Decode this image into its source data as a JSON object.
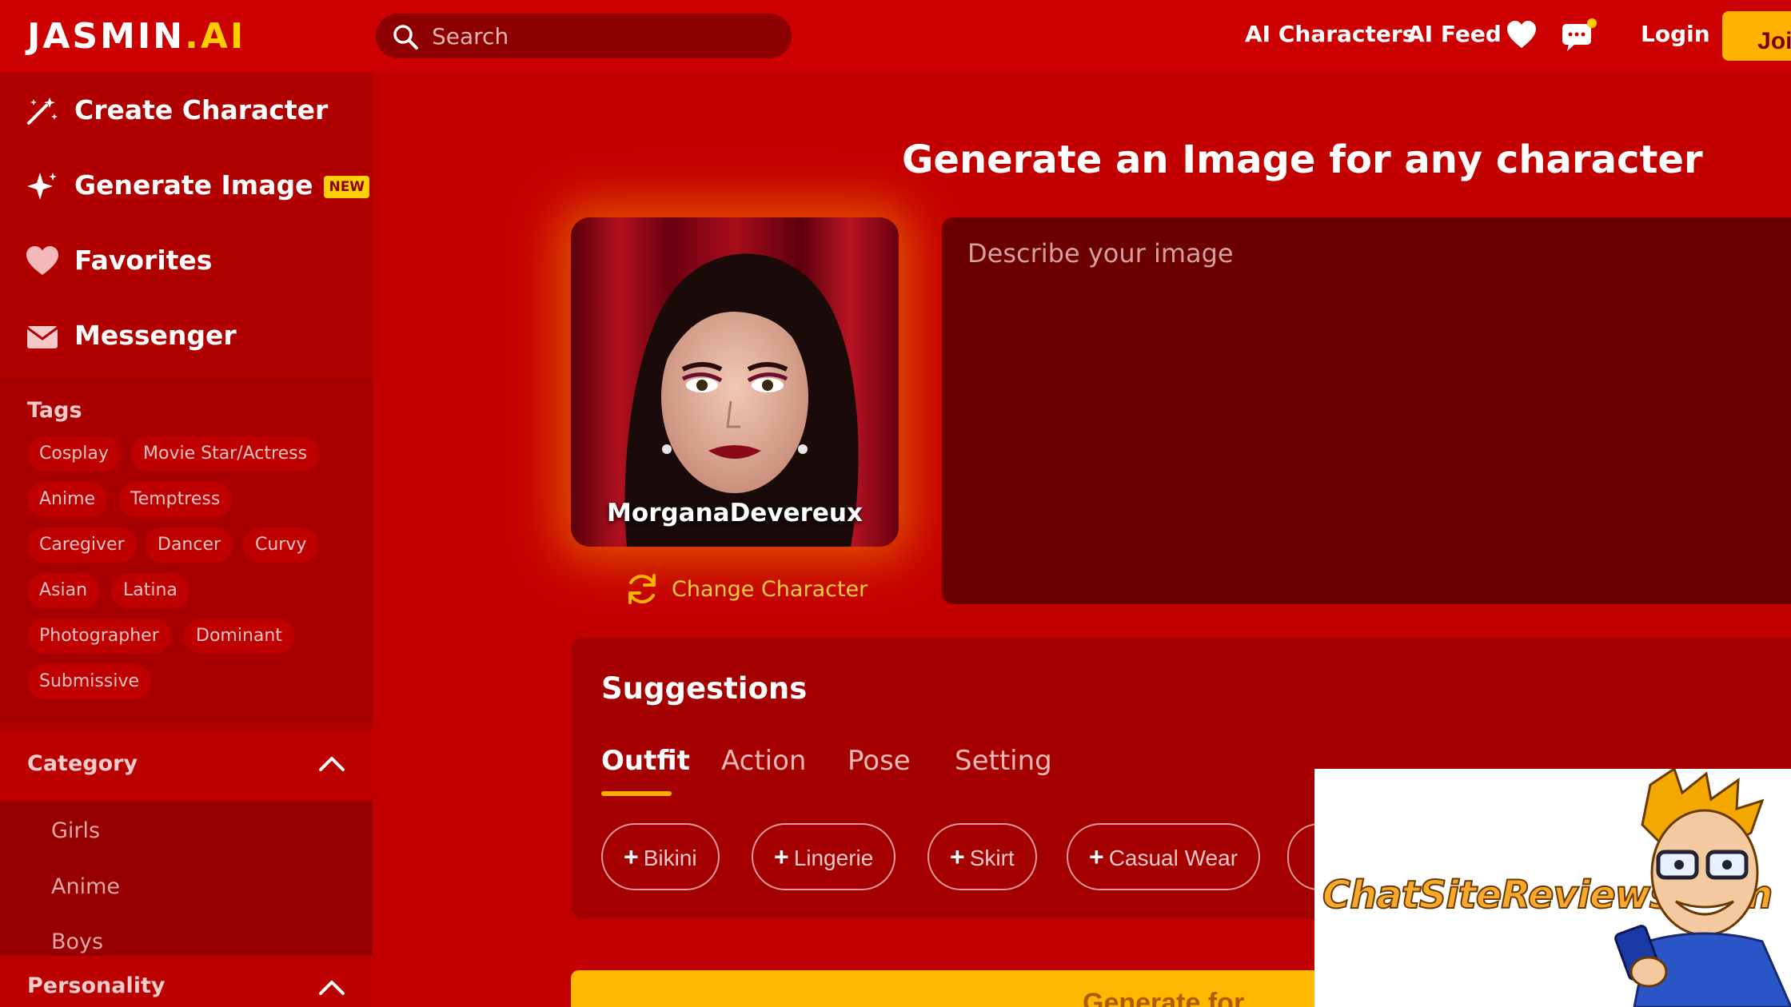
{
  "header": {
    "logo_main": "JASMIN",
    "logo_dot": ".",
    "logo_suffix": "AI",
    "search_placeholder": "Search",
    "nav_ai_characters": "AI Characters",
    "nav_ai_feed": "AI Feed",
    "login": "Login",
    "join": "Join"
  },
  "sidebar": {
    "items": [
      {
        "label": "Create Character",
        "icon": "magic-wand-icon"
      },
      {
        "label": "Generate Image",
        "icon": "sparkle-icon",
        "badge": "NEW"
      },
      {
        "label": "Favorites",
        "icon": "heart-icon"
      },
      {
        "label": "Messenger",
        "icon": "envelope-icon"
      }
    ],
    "tags_title": "Tags",
    "tags": [
      "Cosplay",
      "Movie Star/Actress",
      "Anime",
      "Temptress",
      "Caregiver",
      "Dancer",
      "Curvy",
      "Asian",
      "Latina",
      "Photographer",
      "Dominant",
      "Submissive"
    ],
    "category_title": "Category",
    "categories": [
      "Girls",
      "Anime",
      "Boys"
    ],
    "personality_title": "Personality"
  },
  "main": {
    "heading": "Generate an Image for any character",
    "character_name": "MorganaDevereux",
    "change_character": "Change Character",
    "prompt_placeholder": "Describe your image",
    "suggestions_title": "Suggestions",
    "tabs": [
      "Outfit",
      "Action",
      "Pose",
      "Setting"
    ],
    "active_tab": "Outfit",
    "chips": [
      "Bikini",
      "Lingerie",
      "Skirt",
      "Casual Wear"
    ],
    "generate_label": "Generate for"
  },
  "watermark": {
    "text": "ChatSiteReviews.com"
  },
  "colors": {
    "background": "#c30000",
    "sidebar": "#b00000",
    "accent": "#ffb300",
    "prompt_bg": "#6a0000"
  }
}
